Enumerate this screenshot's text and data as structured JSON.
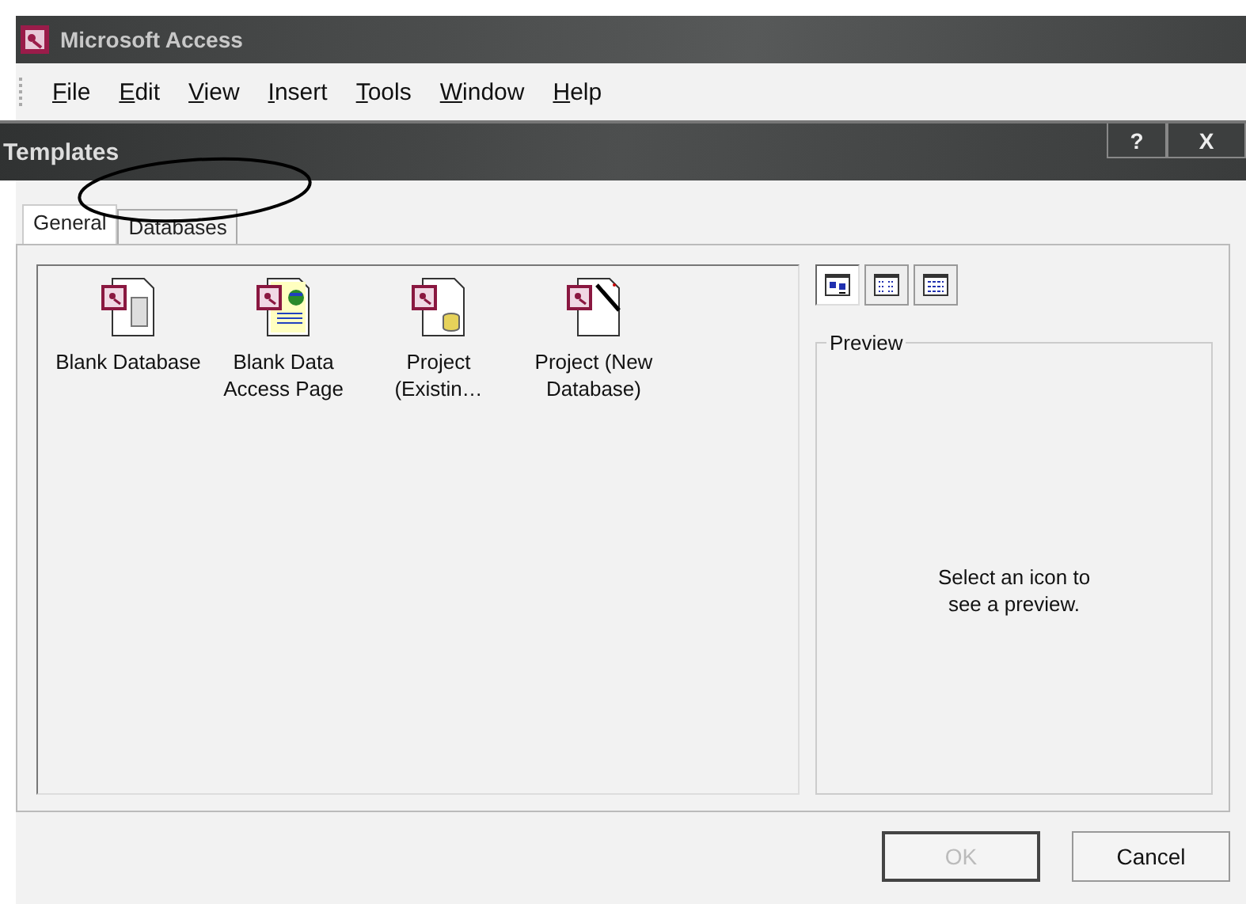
{
  "app_window": {
    "title": "Microsoft Access"
  },
  "menu": [
    {
      "access_key": "F",
      "rest": "ile"
    },
    {
      "access_key": "E",
      "rest": "dit"
    },
    {
      "access_key": "V",
      "rest": "iew"
    },
    {
      "access_key": "I",
      "rest": "nsert"
    },
    {
      "access_key": "T",
      "rest": "ools"
    },
    {
      "access_key": "W",
      "rest": "indow"
    },
    {
      "access_key": "H",
      "rest": "elp"
    }
  ],
  "dialog": {
    "title": "Templates",
    "help_button": "?",
    "close_button": "X"
  },
  "tabs": [
    {
      "label": "General",
      "selected": true
    },
    {
      "label": "Databases",
      "selected": false
    }
  ],
  "templates": [
    {
      "kind": "database",
      "label": "Blank Database"
    },
    {
      "kind": "page",
      "label": "Blank Data Access Page"
    },
    {
      "kind": "project",
      "label": "Project (Existin…"
    },
    {
      "kind": "wizard",
      "label": "Project (New Database)"
    }
  ],
  "view_buttons": [
    {
      "kind": "large",
      "selected": true
    },
    {
      "kind": "list",
      "selected": false
    },
    {
      "kind": "details",
      "selected": false
    }
  ],
  "preview": {
    "label": "Preview",
    "message": "Select an icon to see a preview."
  },
  "buttons": [
    {
      "label": "OK",
      "disabled": true
    },
    {
      "label": "Cancel",
      "disabled": false
    }
  ],
  "annotation": {
    "kind": "ellipse"
  }
}
